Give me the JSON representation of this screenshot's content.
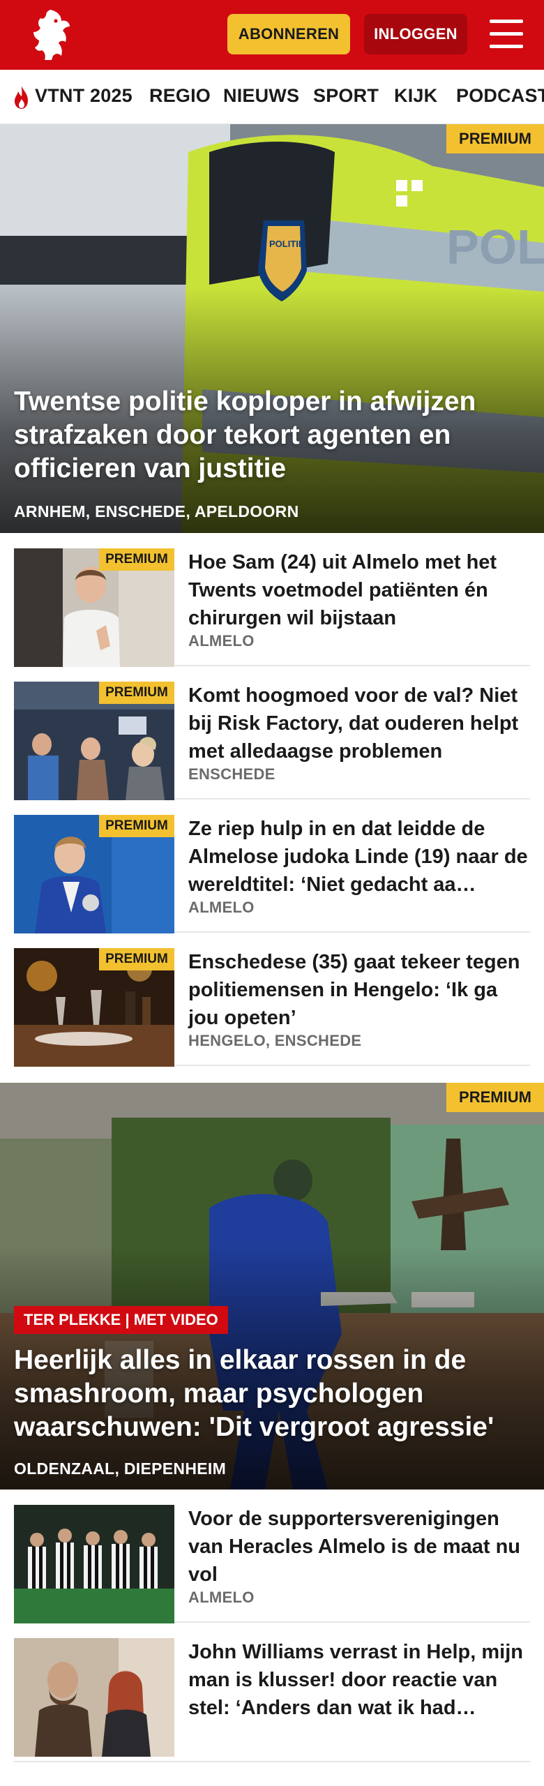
{
  "header": {
    "subscribe_label": "ABONNEREN",
    "login_label": "INLOGGEN",
    "logo_icon": "twente-horse-logo",
    "menu_icon": "hamburger-menu-icon",
    "brand_color": "#d10a11",
    "accent_color": "#f3c130"
  },
  "nav": {
    "items": [
      {
        "label": "VTNT 2025",
        "icon": "flame-icon"
      },
      {
        "label": "REGIO"
      },
      {
        "label": "NIEUWS"
      },
      {
        "label": "SPORT"
      },
      {
        "label": "KIJK"
      },
      {
        "label": "PODCAST"
      }
    ]
  },
  "premium_label": "PREMIUM",
  "hero1": {
    "title": "Twentse politie koploper in afwijzen strafzaken door tekort agenten en officieren van justitie",
    "location": "ARNHEM, ENSCHEDE, APELDOORN",
    "premium": true
  },
  "articles1": [
    {
      "title": "Hoe Sam (24) uit Almelo met het Twents voetmodel patiënten én chirurgen wil bijstaan",
      "location": "ALMELO",
      "premium": true
    },
    {
      "title": "Komt hoogmoed voor de val? Niet bij Risk Factory, dat ouderen helpt met alledaagse problemen",
      "location": "ENSCHEDE",
      "premium": true
    },
    {
      "title": "Ze riep hulp in en dat leidde de Almelose judoka Linde (19) naar de wereldtitel: ‘Niet gedacht aa…",
      "location": "ALMELO",
      "premium": true
    },
    {
      "title": "Enschedese (35) gaat tekeer tegen politiemensen in Hengelo: ‘Ik ga jou opeten’",
      "location": "HENGELO, ENSCHEDE",
      "premium": true
    }
  ],
  "hero2": {
    "tag": "TER PLEKKE | MET VIDEO",
    "title": "Heerlijk alles in elkaar rossen in de smashroom, maar psychologen waarschuwen: 'Dit vergroot agressie'",
    "location": "OLDENZAAL, DIEPENHEIM",
    "premium": true
  },
  "articles2": [
    {
      "title": "Voor de supportersverenigingen van Heracles Almelo is de maat nu vol",
      "location": "ALMELO",
      "premium": false
    },
    {
      "title": "John Williams verrast in Help, mijn man is klusser! door reactie van stel: ‘Anders dan wat ik had…",
      "location": "",
      "premium": false
    }
  ]
}
